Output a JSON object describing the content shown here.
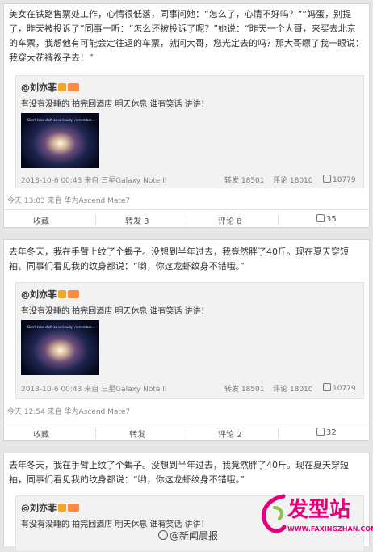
{
  "posts": [
    {
      "text": "美女在铁路售票处工作，心情很低落，同事问她：“怎么了，心情不好吗？”“妈蛋，别提了，昨天被投诉了”同事一听：“怎么还被投诉了呢？”她说：“昨天一个大哥，来买去北京的车票，我想他有可能会定往返的车票，就问大哥，您光定去的吗？那大哥瞟了我一眼说：我穿大花裤衩子去！”",
      "quote": {
        "author": "@刘亦菲",
        "text": "有没有没睡的 拍完回酒店 明天休息 谁有笑话 讲讲！",
        "thumb_caption": "Don't take stuff so seriously, remember...",
        "meta": "2013-10-6 00:43 来自 三星Galaxy Note II",
        "repost": "转发 18501",
        "comment": "评论 18010",
        "like": "10779"
      },
      "time": "今天 13:03 来自 华为Ascend Mate7",
      "actions": {
        "fav": "收藏",
        "repost": "转发 3",
        "comment": "评论 8",
        "like": "35"
      }
    },
    {
      "text": "去年冬天，我在手臂上纹了个蝎子。没想到半年过去，我竟然胖了40斤。现在夏天穿短袖，同事们看见我的纹身都说：“哟，你这龙虾纹身不错哦。”",
      "quote": {
        "author": "@刘亦菲",
        "text": "有没有没睡的 拍完回酒店 明天休息 谁有笑话 讲讲！",
        "thumb_caption": "Don't take stuff so seriously, remember...",
        "meta": "2013-10-6 00:43 来自 三星Galaxy Note II",
        "repost": "转发 18501",
        "comment": "评论 18010",
        "like": "10779"
      },
      "time": "今天 12:54 来自 华为Ascend Mate7",
      "actions": {
        "fav": "收藏",
        "repost": "转发",
        "comment": "评论 2",
        "like": "32"
      }
    },
    {
      "text": "去年冬天，我在手臂上纹了个蝎子。没想到半年过去，我竟然胖了40斤。现在夏天穿短袖，同事们看见我的纹身都说：“哟，你这龙虾纹身不错哦。”",
      "quote": {
        "author": "@刘亦菲",
        "text": "有没有没睡的 拍完回酒店 明天休息 谁有笑话 讲讲！"
      }
    }
  ],
  "watermark": {
    "source": "@新闻晨报",
    "site_name": "发型站",
    "site_url": "WWW.FAXINGZHAN.COM",
    "brand_color": "#e6007e"
  }
}
